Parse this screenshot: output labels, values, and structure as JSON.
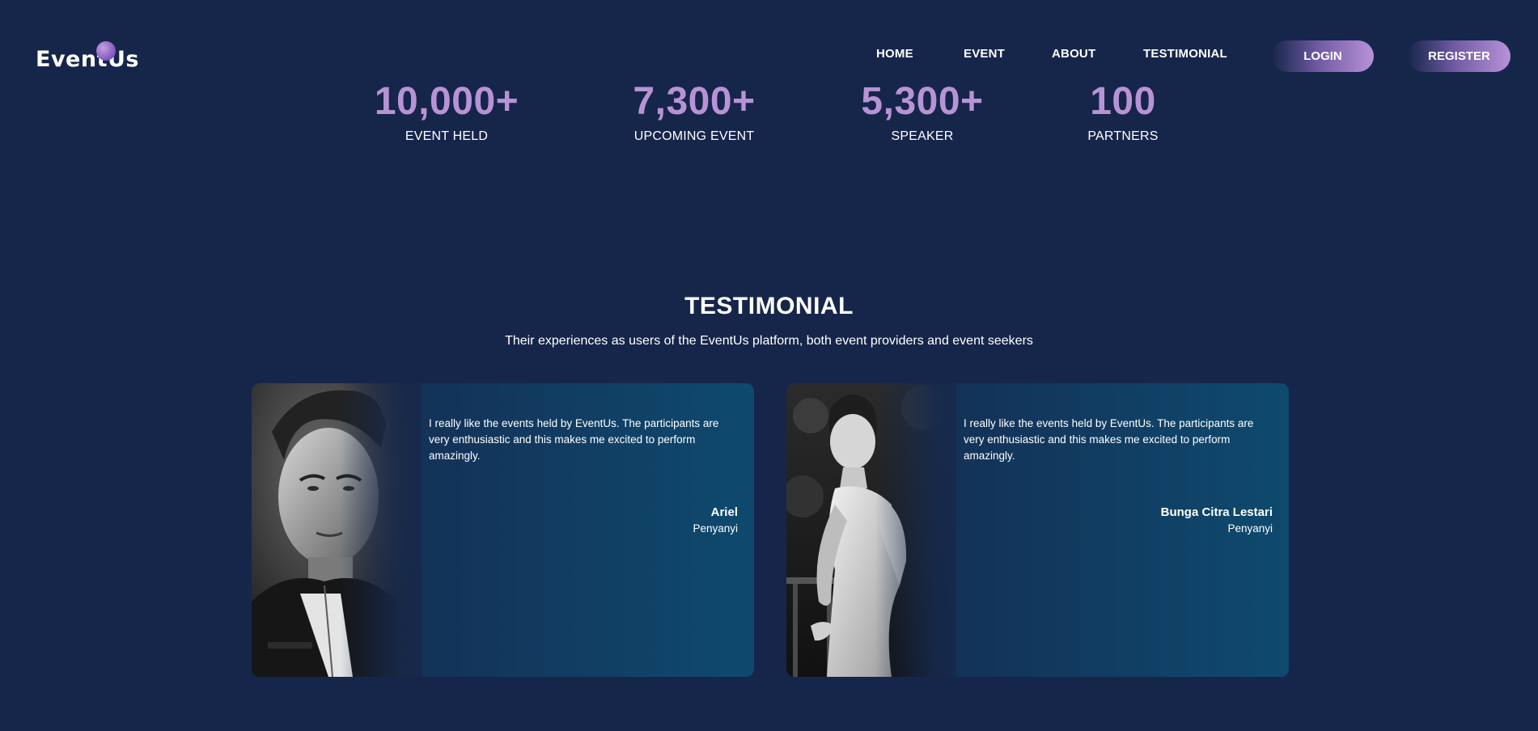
{
  "header": {
    "logo": "EventUs",
    "nav": [
      "HOME",
      "EVENT",
      "ABOUT",
      "TESTIMONIAL"
    ],
    "login_label": "LOGIN",
    "register_label": "REGISTER"
  },
  "stats": [
    {
      "value": "10,000+",
      "label": "EVENT HELD"
    },
    {
      "value": "7,300+",
      "label": "UPCOMING EVENT"
    },
    {
      "value": "5,300+",
      "label": "SPEAKER"
    },
    {
      "value": "100",
      "label": "PARTNERS"
    }
  ],
  "testimonial": {
    "title": "TESTIMONIAL",
    "subtitle": "Their experiences as users of the EventUs platform, both event providers and event seekers",
    "cards": [
      {
        "quote": "I really like the events held by EventUs. The participants are very enthusiastic and this makes me excited to perform amazingly.",
        "name": "Ariel",
        "role": "Penyanyi"
      },
      {
        "quote": "I really like the events held by EventUs. The participants are very enthusiastic and this makes me excited to perform amazingly.",
        "name": "Bunga Citra Lestari",
        "role": "Penyanyi"
      }
    ]
  },
  "colors": {
    "background": "#16264a",
    "accent": "#b793d6",
    "card_start": "#162a4e",
    "card_end": "#0e4a6e"
  }
}
